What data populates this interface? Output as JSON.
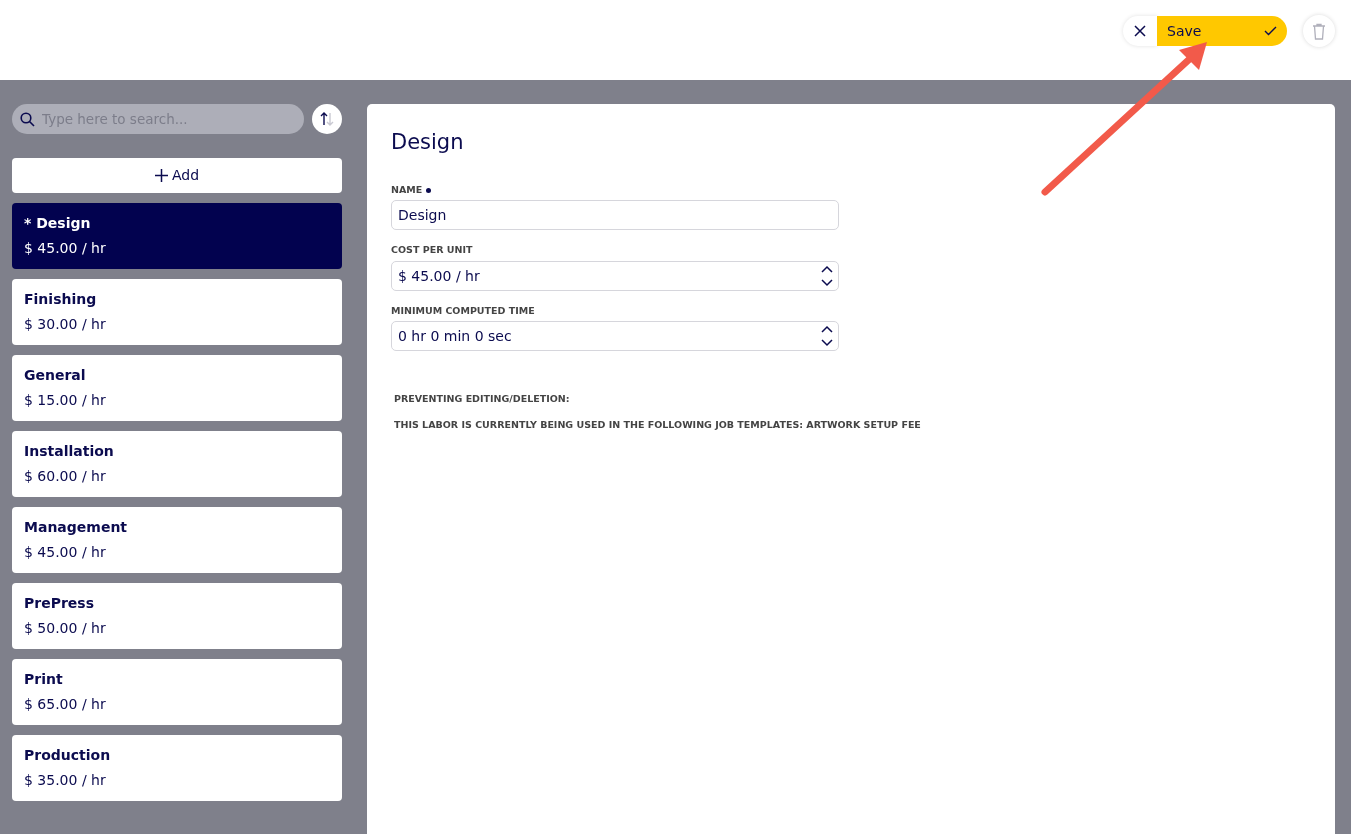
{
  "toolbar": {
    "save_label": "Save"
  },
  "search": {
    "placeholder": "Type here to search..."
  },
  "add_label": "Add",
  "items": [
    {
      "name": "* Design",
      "rate": "$ 45.00 / hr",
      "selected": true
    },
    {
      "name": "Finishing",
      "rate": "$ 30.00 / hr",
      "selected": false
    },
    {
      "name": "General",
      "rate": "$ 15.00 / hr",
      "selected": false
    },
    {
      "name": "Installation",
      "rate": "$ 60.00 / hr",
      "selected": false
    },
    {
      "name": "Management",
      "rate": "$ 45.00 / hr",
      "selected": false
    },
    {
      "name": "PrePress",
      "rate": "$ 50.00 / hr",
      "selected": false
    },
    {
      "name": "Print",
      "rate": "$ 65.00 / hr",
      "selected": false
    },
    {
      "name": "Production",
      "rate": "$ 35.00 / hr",
      "selected": false
    }
  ],
  "detail": {
    "title": "Design",
    "fields": [
      {
        "label": "NAME",
        "required": true,
        "value": "Design",
        "kind": "text"
      },
      {
        "label": "COST PER UNIT",
        "required": false,
        "value": "$ 45.00 / hr",
        "kind": "spinner"
      },
      {
        "label": "MINIMUM COMPUTED TIME",
        "required": false,
        "value": "0 hr 0 min 0 sec",
        "kind": "spinner"
      }
    ],
    "notes": [
      "PREVENTING EDITING/DELETION:",
      "THIS LABOR IS CURRENTLY BEING USED IN THE FOLLOWING JOB TEMPLATES: ARTWORK SETUP FEE"
    ]
  }
}
